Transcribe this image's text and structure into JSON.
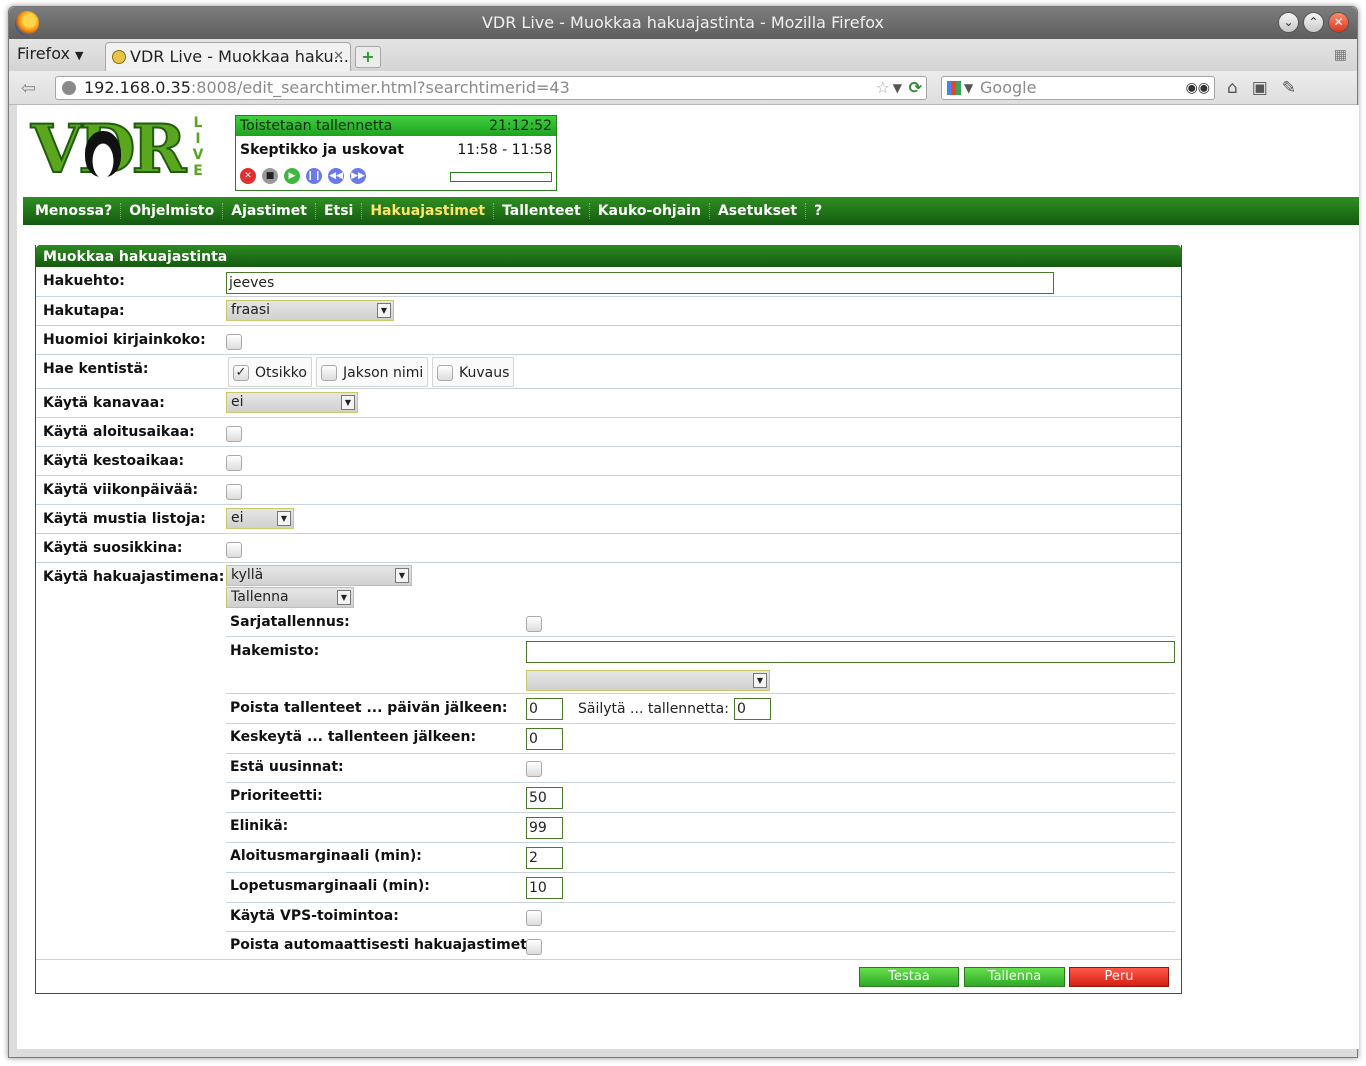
{
  "window": {
    "title": "VDR Live - Muokkaa hakuajastinta - Mozilla Firefox",
    "firefox_menu": "Firefox",
    "tab_title": "VDR Live - Muokkaa haku...",
    "new_tab": "+",
    "url_host": "192.168.0.35",
    "url_rest": ":8008/edit_searchtimer.html?searchtimerid=43",
    "search_placeholder": "Google"
  },
  "logo": {
    "letters": "VDR",
    "live": [
      "L",
      "I",
      "V",
      "E"
    ]
  },
  "status": {
    "heading": "Toistetaan tallennetta",
    "time": "21:12:52",
    "title": "Skeptikko ja uskovat",
    "span": "11:58 - 11:58",
    "progress": 0
  },
  "menu": {
    "items": [
      "Menossa?",
      "Ohjelmisto",
      "Ajastimet",
      "Etsi",
      "Hakuajastimet",
      "Tallenteet",
      "Kauko-ohjain",
      "Asetukset",
      "?"
    ],
    "active": "Hakuajastimet"
  },
  "form": {
    "heading": "Muokkaa hakuajastinta",
    "search_term_label": "Hakuehto:",
    "search_term_value": "jeeves",
    "search_mode_label": "Hakutapa:",
    "search_mode_value": "fraasi",
    "match_case_label": "Huomioi kirjainkoko:",
    "search_in_label": "Hae kentistä:",
    "search_in": [
      {
        "label": "Otsikko",
        "checked": true
      },
      {
        "label": "Jakson nimi",
        "checked": false
      },
      {
        "label": "Kuvaus",
        "checked": false
      }
    ],
    "use_channel_label": "Käytä kanavaa:",
    "use_channel_value": "ei",
    "use_start_label": "Käytä aloitusaikaa:",
    "use_duration_label": "Käytä kestoaikaa:",
    "use_weekday_label": "Käytä viikonpäivää:",
    "use_blacklist_label": "Käytä mustia listoja:",
    "use_blacklist_value": "ei",
    "use_favorite_label": "Käytä suosikkina:",
    "use_as_timer_label": "Käytä hakuajastimena:",
    "use_as_timer_value": "kyllä",
    "timer_action_value": "Tallenna",
    "series_label": "Sarjatallennus:",
    "directory_label": "Hakemisto:",
    "directory_value": "",
    "directory_select_value": "",
    "delete_after_label": "Poista tallenteet ... päivän jälkeen:",
    "delete_after_value": "0",
    "keep_label": "Säilytä ... tallennetta:",
    "keep_value": "0",
    "pause_after_label": "Keskeytä ... tallenteen jälkeen:",
    "pause_after_value": "0",
    "avoid_repeats_label": "Estä uusinnat:",
    "priority_label": "Prioriteetti:",
    "priority_value": "50",
    "lifetime_label": "Elinikä:",
    "lifetime_value": "99",
    "margin_start_label": "Aloitusmarginaali (min):",
    "margin_start_value": "2",
    "margin_stop_label": "Lopetusmarginaali (min):",
    "margin_stop_value": "10",
    "vps_label": "Käytä VPS-toimintoa:",
    "auto_delete_label": "Poista automaattisesti hakuajastimet:",
    "btn_test": "Testaa",
    "btn_save": "Tallenna",
    "btn_cancel": "Peru"
  },
  "colors": {
    "menu_green": "#145a10",
    "active_menu": "#ffe36a",
    "button_green": "#2fa82a",
    "button_red": "#d61e12"
  }
}
